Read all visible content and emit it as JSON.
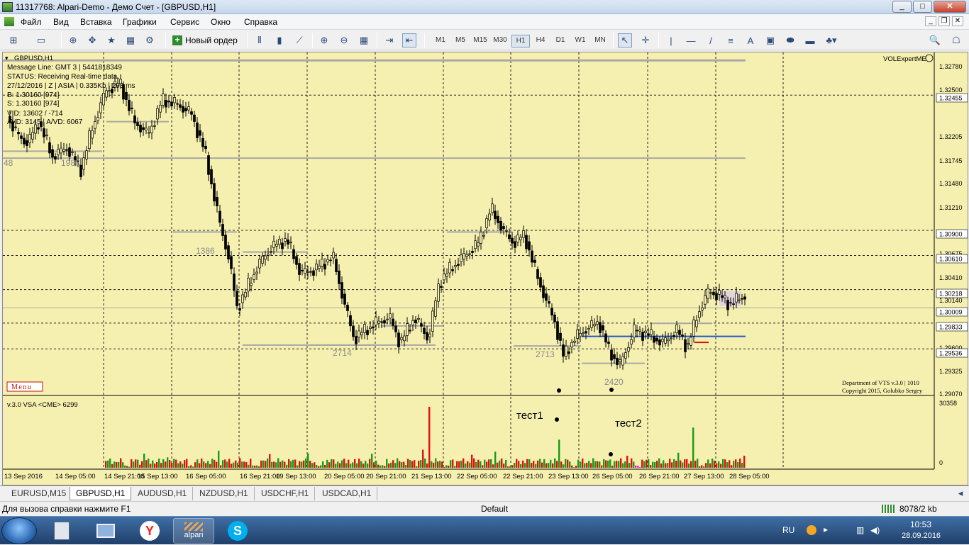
{
  "window": {
    "title": "11317768: Alpari-Demo - Демо Счет - [GBPUSD,H1]"
  },
  "menu": [
    "Файл",
    "Вид",
    "Вставка",
    "Графики",
    "Сервис",
    "Окно",
    "Справка"
  ],
  "toolbar": {
    "new_order": "Новый ордер",
    "timeframes": [
      "M1",
      "M5",
      "M15",
      "M30",
      "H1",
      "H4",
      "D1",
      "W1",
      "MN"
    ],
    "active_timeframe": "H1"
  },
  "chart": {
    "symbol_label": "GBPUSD,H1",
    "info_lines": [
      "Message Line: GMT 3 | 5441818349",
      "STATUS:  Receiving Real-time data.",
      "27/12/2016 | Z | ASIA | 0.335Kb | 203 ms",
      "B: 1.30160 [974]",
      "S: 1.30160  [974]",
      "VID: 13602 / -714",
      "AVD: 3145 | A/VD: 6067"
    ],
    "indicator_name": "VOLExpertME",
    "menu_button": "Menu",
    "copyright_1": "Department of VTS  v.3.0 | 1010",
    "copyright_2": "Copyright 2015, Golubko Sergey",
    "subwindow_label": "v.3.0 VSA <CME> 6299",
    "sub_max": "30358",
    "sub_min": "0",
    "annotations": [
      "тест1",
      "тест2"
    ],
    "zone_labels": [
      "48",
      "1988",
      "1386",
      "2714",
      "2713",
      "2420"
    ],
    "price_scale": [
      "1.32780",
      "1.32500",
      "1.32205",
      "1.31745",
      "1.31480",
      "1.31210",
      "1.30675",
      "1.30410",
      "1.30140",
      "1.29600",
      "1.29325",
      "1.29070"
    ],
    "price_tags": [
      {
        "label": "1.32455",
        "color": "#ffffff"
      },
      {
        "label": "1.30900",
        "color": "#ffffff"
      },
      {
        "label": "1.30610",
        "color": "#ffffff"
      },
      {
        "label": "1.30218",
        "color": "#ffffff"
      },
      {
        "label": "1.30009",
        "color": "#ffffff"
      },
      {
        "label": "1.29833",
        "color": "#ffffff"
      },
      {
        "label": "1.29536",
        "color": "#ffffff"
      }
    ],
    "time_axis": [
      "13 Sep 2016",
      "14 Sep 05:00",
      "14 Sep 21:00",
      "15 Sep 13:00",
      "16 Sep 05:00",
      "16 Sep 21:00",
      "19 Sep 13:00",
      "20 Sep 05:00",
      "20 Sep 21:00",
      "21 Sep 13:00",
      "22 Sep 05:00",
      "22 Sep 21:00",
      "23 Sep 13:00",
      "26 Sep 05:00",
      "26 Sep 21:00",
      "27 Sep 13:00",
      "28 Sep 05:00"
    ],
    "colors": {
      "background": "#f6f0b0",
      "volume_up": "#1a9a1a",
      "volume_down": "#e01010",
      "level_line": "#1e56c8"
    }
  },
  "tabs": [
    "EURUSD,M15",
    "GBPUSD,H1",
    "AUDUSD,H1",
    "NZDUSD,H1",
    "USDCHF,H1",
    "USDCAD,H1"
  ],
  "active_tab": "GBPUSD,H1",
  "status": {
    "help": "Для вызова справки нажмите F1",
    "profile": "Default",
    "traffic": "8078/2 kb"
  },
  "taskbar": {
    "lang": "RU",
    "time": "10:53",
    "date": "28.09.2016",
    "alpari_label": "alpari"
  }
}
